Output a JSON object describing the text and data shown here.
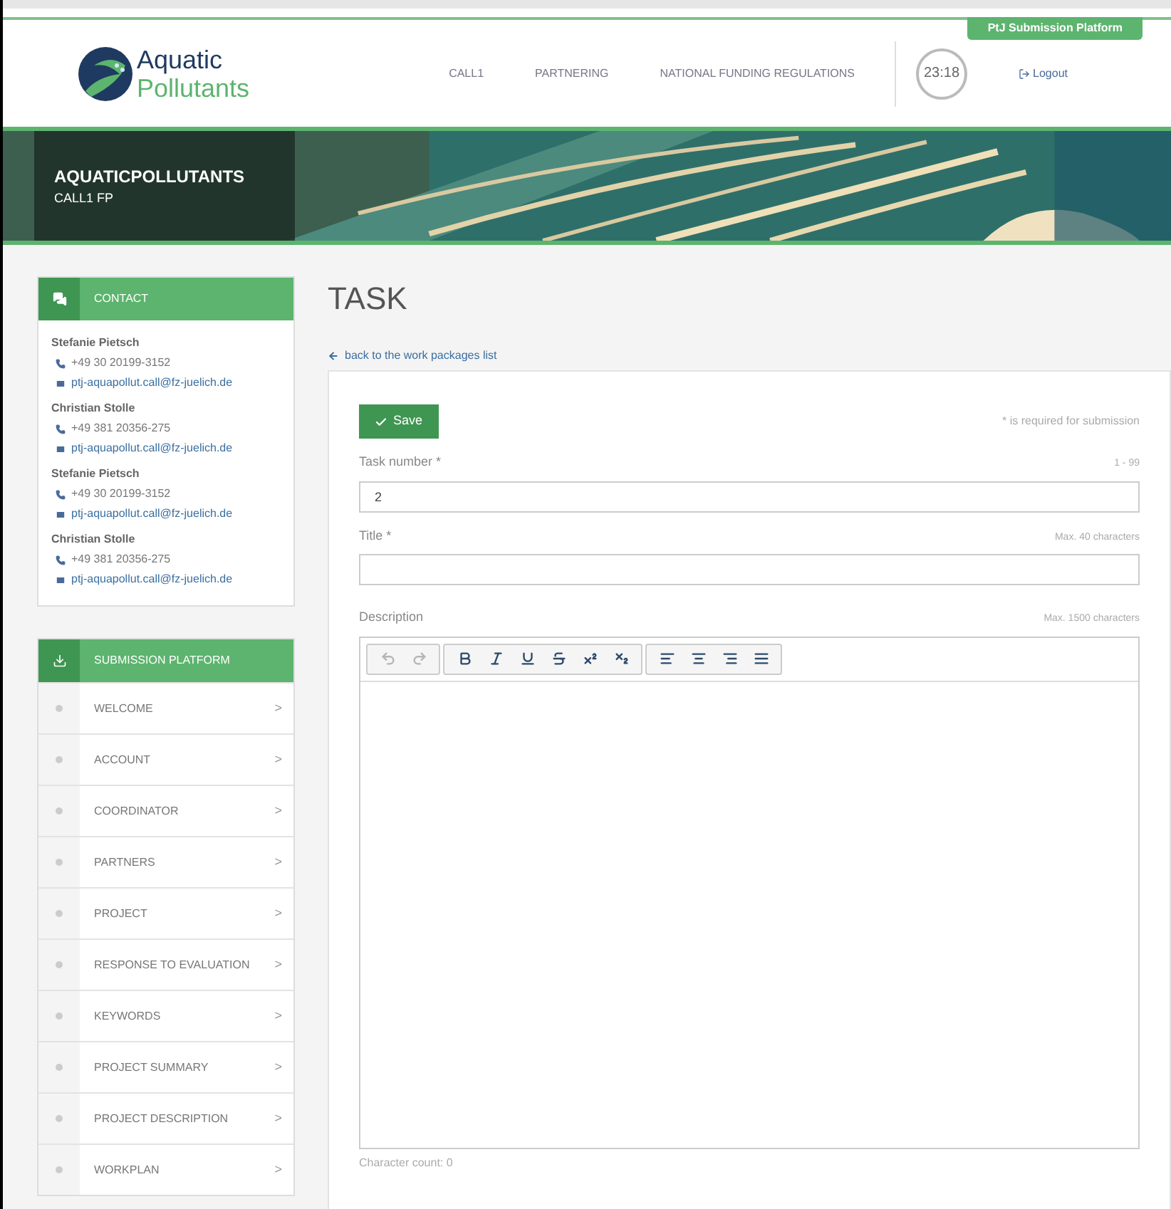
{
  "header": {
    "logo": {
      "line_1": "Aquatic",
      "line_2": "Pollutants"
    },
    "platform_tab": "PtJ Submission Platform",
    "nav": [
      {
        "label": "CALL1"
      },
      {
        "label": "PARTNERING"
      },
      {
        "label": "NATIONAL FUNDING REGULATIONS"
      }
    ],
    "timer": "23:18",
    "logout": "Logout"
  },
  "banner": {
    "kind": "picture",
    "title": "AQUATICPOLLUTANTS",
    "subtitle": "CALL1 FP"
  },
  "contact": {
    "heading": "CONTACT",
    "people": [
      {
        "name": "Stefanie Pietsch",
        "phone": "+49 30 20199-3152",
        "email": "ptj-aquapollut.call@fz-juelich.de"
      },
      {
        "name": "Christian Stolle",
        "phone": "+49 381 20356-275",
        "email": "ptj-aquapollut.call@fz-juelich.de"
      },
      {
        "name": "Stefanie Pietsch",
        "phone": "+49 30 20199-3152",
        "email": "ptj-aquapollut.call@fz-juelich.de"
      },
      {
        "name": "Christian Stolle",
        "phone": "+49 381 20356-275",
        "email": "ptj-aquapollut.call@fz-juelich.de"
      }
    ]
  },
  "submission_menu": {
    "heading": "SUBMISSION PLATFORM",
    "items": [
      {
        "label": "WELCOME",
        "chevron": ">"
      },
      {
        "label": "ACCOUNT",
        "chevron": ">"
      },
      {
        "label": "COORDINATOR",
        "chevron": ">"
      },
      {
        "label": "PARTNERS",
        "chevron": ">"
      },
      {
        "label": "PROJECT",
        "chevron": ">"
      },
      {
        "label": "RESPONSE TO EVALUATION",
        "chevron": ">"
      },
      {
        "label": "KEYWORDS",
        "chevron": ">"
      },
      {
        "label": "PROJECT SUMMARY",
        "chevron": ">"
      },
      {
        "label": "PROJECT DESCRIPTION",
        "chevron": ">"
      },
      {
        "label": "WORKPLAN",
        "chevron": ">"
      }
    ]
  },
  "page": {
    "title": "TASK",
    "back_link": "back to the work packages list",
    "save_button": "Save",
    "required_note": "* is required for submission",
    "fields": [
      {
        "label": "Task number *",
        "hint": "1 - 99",
        "value": "2"
      },
      {
        "label": "Title *",
        "hint": "Max. 40 characters"
      }
    ],
    "description": {
      "label": "Description",
      "hint": "Max. 1500 characters",
      "character_count": "Character count: 0",
      "toolbar": [
        [
          {
            "kind": "undo",
            "disabled": true
          },
          {
            "kind": "redo",
            "disabled": true
          }
        ],
        [
          {
            "kind": "bold",
            "disabled": false
          },
          {
            "kind": "italic",
            "disabled": false
          },
          {
            "kind": "underline",
            "disabled": false
          },
          {
            "kind": "strikethrough",
            "disabled": false
          },
          {
            "kind": "superscript",
            "disabled": false
          },
          {
            "kind": "subscript",
            "disabled": false
          }
        ],
        [
          {
            "kind": "align-left",
            "disabled": false
          },
          {
            "kind": "align-center",
            "disabled": false
          },
          {
            "kind": "align-right",
            "disabled": false
          },
          {
            "kind": "align-justify",
            "disabled": false
          }
        ]
      ]
    }
  }
}
